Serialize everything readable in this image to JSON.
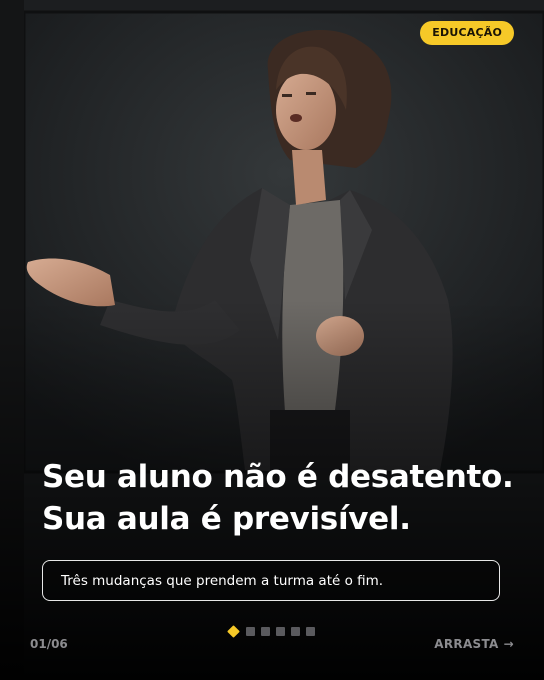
{
  "colors": {
    "accent": "#f6c928",
    "background": "#0b0b0c",
    "muted_text": "#8c8c90"
  },
  "badge": {
    "label": "EDUCAÇÃO"
  },
  "headline": {
    "line1": "Seu aluno não é desatento.",
    "line2": "Sua aula é previsível."
  },
  "subtitle": "Três mudanças que prendem a turma até o fim.",
  "pagination": {
    "current_index": 1,
    "total": 6
  },
  "footer": {
    "counter": "01/06",
    "swipe_label": "ARRASTA",
    "swipe_icon": "arrow-right-icon"
  },
  "photo": {
    "subject": "teacher-speaking-in-classroom"
  }
}
